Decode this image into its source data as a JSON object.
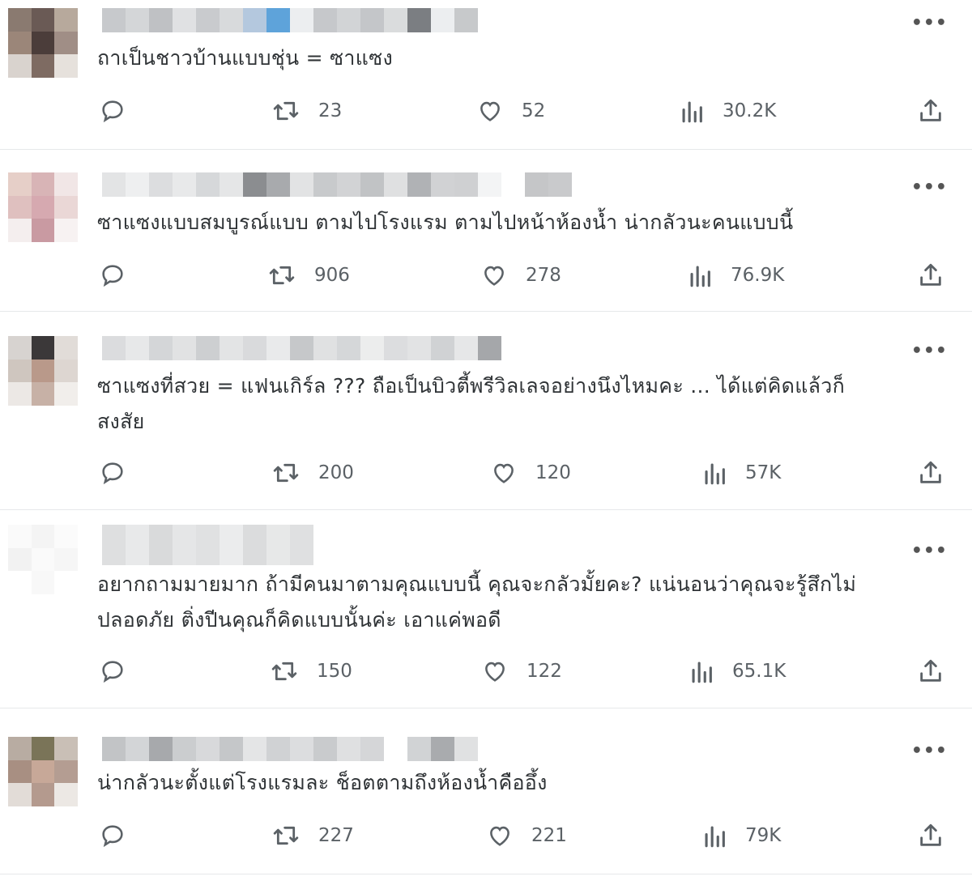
{
  "more_label": "•••",
  "replies": [
    {
      "text": "ถาเป็นชาวบ้านแบบชุ่น = ซาแซง",
      "retweets": "23",
      "likes": "52",
      "views": "30.2K"
    },
    {
      "text": "ซาแซงแบบสมบูรณ์แบบ ตามไปโรงแรม ตามไปหน้าห้องน้ำ น่ากลัวนะคนแบบนี้",
      "retweets": "906",
      "likes": "278",
      "views": "76.9K"
    },
    {
      "text_line1": "ซาแซงที่สวย = แฟนเกิร์ล ??? ถือเป็นบิวตี้พรีวิลเลจอย่างนึงไหมคะ ... ได้แต่คิดแล้วก็",
      "text_line2": "สงสัย",
      "retweets": "200",
      "likes": "120",
      "views": "57K"
    },
    {
      "text_line1": "อยากถามมายมาก ถ้ามีคนมาตามคุณแบบนี้ คุณจะกลัวมั้ยคะ? แน่นอนว่าคุณจะรู้สึกไม่",
      "text_line2": "ปลอดภัย ติ่งปีนคุณก็คิดแบบนั้นค่ะ เอาแค่พอดี",
      "retweets": "150",
      "likes": "122",
      "views": "65.1K"
    },
    {
      "text": "น่ากลัวนะตั้งแต่โรงแรมละ ช็อตตามถึงห้องน้ำคืออึ้ง",
      "retweets": "227",
      "likes": "221",
      "views": "79K"
    }
  ]
}
